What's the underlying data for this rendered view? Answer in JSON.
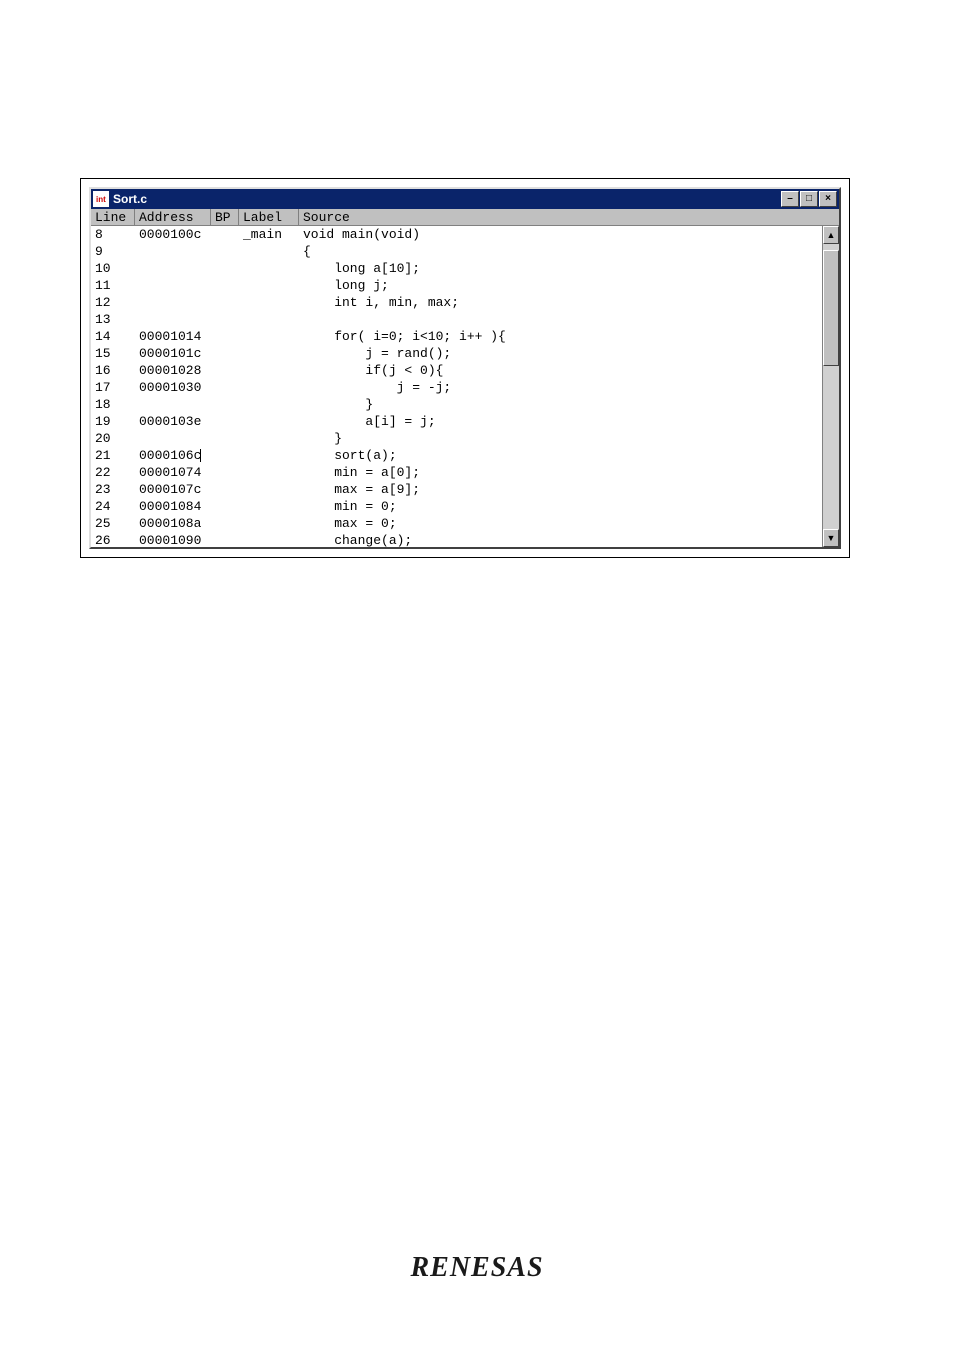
{
  "brand": {
    "footer_logo": "RENESAS"
  },
  "window": {
    "title": "Sort.c",
    "controls": {
      "minimize_glyph": "–",
      "maximize_glyph": "□",
      "close_glyph": "×"
    }
  },
  "columns": {
    "line": "Line",
    "address": "Address",
    "bp": "BP",
    "label": "Label",
    "source": "Source"
  },
  "scroll": {
    "up_glyph": "▲",
    "down_glyph": "▼"
  },
  "rows": [
    {
      "line": "8",
      "address": "0000100c",
      "bp": "",
      "label": "_main",
      "source": "void main(void)"
    },
    {
      "line": "9",
      "address": "",
      "bp": "",
      "label": "",
      "source": "{"
    },
    {
      "line": "10",
      "address": "",
      "bp": "",
      "label": "",
      "source": "    long a[10];"
    },
    {
      "line": "11",
      "address": "",
      "bp": "",
      "label": "",
      "source": "    long j;"
    },
    {
      "line": "12",
      "address": "",
      "bp": "",
      "label": "",
      "source": "    int i, min, max;"
    },
    {
      "line": "13",
      "address": "",
      "bp": "",
      "label": "",
      "source": ""
    },
    {
      "line": "14",
      "address": "00001014",
      "bp": "",
      "label": "",
      "source": "    for( i=0; i<10; i++ ){"
    },
    {
      "line": "15",
      "address": "0000101c",
      "bp": "",
      "label": "",
      "source": "        j = rand();"
    },
    {
      "line": "16",
      "address": "00001028",
      "bp": "",
      "label": "",
      "source": "        if(j < 0){"
    },
    {
      "line": "17",
      "address": "00001030",
      "bp": "",
      "label": "",
      "source": "            j = -j;"
    },
    {
      "line": "18",
      "address": "",
      "bp": "",
      "label": "",
      "source": "        }"
    },
    {
      "line": "19",
      "address": "0000103e",
      "bp": "",
      "label": "",
      "source": "        a[i] = j;"
    },
    {
      "line": "20",
      "address": "",
      "bp": "",
      "label": "",
      "source": "    }"
    },
    {
      "line": "21",
      "address": "0000106c",
      "bp": "",
      "label": "",
      "source": "    sort(a);",
      "cursor_after_address": true
    },
    {
      "line": "22",
      "address": "00001074",
      "bp": "",
      "label": "",
      "source": "    min = a[0];"
    },
    {
      "line": "23",
      "address": "0000107c",
      "bp": "",
      "label": "",
      "source": "    max = a[9];"
    },
    {
      "line": "24",
      "address": "00001084",
      "bp": "",
      "label": "",
      "source": "    min = 0;"
    },
    {
      "line": "25",
      "address": "0000108a",
      "bp": "",
      "label": "",
      "source": "    max = 0;"
    },
    {
      "line": "26",
      "address": "00001090",
      "bp": "",
      "label": "",
      "source": "    change(a);"
    }
  ]
}
